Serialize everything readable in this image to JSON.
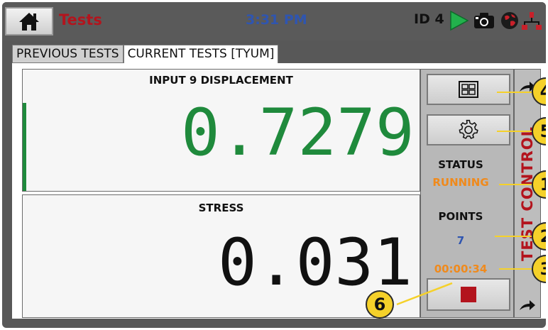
{
  "header": {
    "title": "Tests",
    "time": "3:31 PM",
    "id_label": "ID 4",
    "icons": [
      "home-icon",
      "play-icon",
      "camera-icon",
      "globe-icon",
      "network-icon"
    ]
  },
  "tabs": [
    {
      "label": "PREVIOUS TESTS",
      "active": false
    },
    {
      "label": "CURRENT TESTS [TYUM]",
      "active": true
    }
  ],
  "panels": {
    "top": {
      "label": "INPUT 9 DISPLACEMENT",
      "value": "0.7279",
      "color": "#1f8a3c"
    },
    "bottom": {
      "label": "STRESS",
      "value": "0.031",
      "color": "#111111"
    }
  },
  "control": {
    "status_label": "STATUS",
    "status_value": "RUNNING",
    "points_label": "POINTS",
    "points_value": "7",
    "elapsed": "00:00:34",
    "side_label": "TEST CONTROL",
    "status_color": "#f08a1c",
    "points_color": "#2f55b0",
    "stop_color": "#b3141d"
  },
  "callouts": [
    "4",
    "5",
    "1",
    "2",
    "3",
    "6"
  ]
}
